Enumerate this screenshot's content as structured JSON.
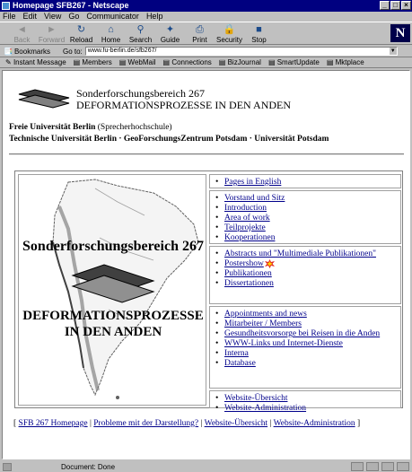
{
  "window": {
    "title": "Homepage SFB267 - Netscape"
  },
  "menu": [
    "File",
    "Edit",
    "View",
    "Go",
    "Communicator",
    "Help"
  ],
  "toolbar": [
    {
      "label": "Back",
      "icon": "◄",
      "enabled": false
    },
    {
      "label": "Forward",
      "icon": "►",
      "enabled": false
    },
    {
      "label": "Reload",
      "icon": "↻",
      "enabled": true
    },
    {
      "label": "Home",
      "icon": "⌂",
      "enabled": true
    },
    {
      "label": "Search",
      "icon": "⚲",
      "enabled": true
    },
    {
      "label": "Guide",
      "icon": "✦",
      "enabled": true
    },
    {
      "label": "Print",
      "icon": "⎙",
      "enabled": true
    },
    {
      "label": "Security",
      "icon": "🔒",
      "enabled": true
    },
    {
      "label": "Stop",
      "icon": "■",
      "enabled": true
    }
  ],
  "logo_letter": "N",
  "location": {
    "bookmarks_label": "Bookmarks",
    "goto_label": "Go to:",
    "url": "www.fu-berlin.de/sfb267/"
  },
  "personal_toolbar": [
    "Instant Message",
    "Members",
    "WebMail",
    "Connections",
    "BizJournal",
    "SmartUpdate",
    "Mktplace"
  ],
  "page": {
    "title_line1": "Sonderforschungsbereich 267",
    "title_line2": "DEFORMATIONSPROZESSE IN DEN ANDEN",
    "inst1_bold": "Freie Universität Berlin",
    "inst1_rest": " (Sprecherhochschule)",
    "inst2": "Technische Universität Berlin · GeoForschungsZentrum Potsdam · Universität Potsdam",
    "map_title1": "Sonderforschungsbereich 267",
    "map_title2a": "DEFORMATIONSPROZESSE",
    "map_title2b": "IN DEN ANDEN",
    "groups": [
      [
        "Pages in English"
      ],
      [
        "Vorstand und Sitz",
        "Introduction",
        "Area of work",
        "Teilprojekte",
        "Kooperationen"
      ],
      [
        "Abstracts und \"Multimediale Publikationen\"",
        "Postershow",
        "Publikationen",
        "Dissertationen"
      ],
      [
        "Appointments and news",
        "Mitarbeiter / Members",
        "Gesundheitsvorsorge bei Reisen in die Anden",
        "WWW-Links und Internet-Dienste",
        "Interna",
        "Database"
      ],
      [
        "Website-Übersicht",
        "Website-Administration"
      ]
    ],
    "footer": [
      "SFB 267 Homepage",
      "Probleme mit der Darstellung?",
      "Website-Übersicht",
      "Website-Administration"
    ]
  },
  "status": {
    "text": "Document: Done"
  },
  "colors": {
    "titlebar": "#000080",
    "link": "#00008b",
    "chrome": "#c0c0c0"
  }
}
